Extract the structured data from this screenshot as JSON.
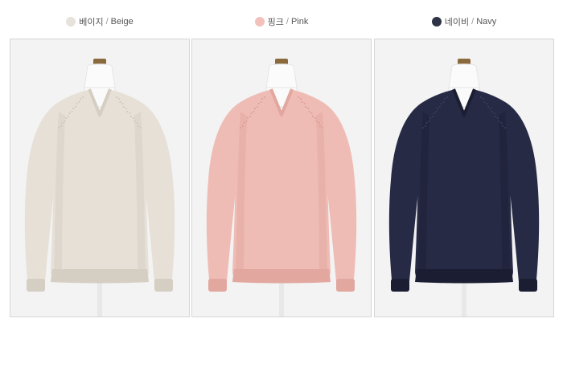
{
  "products": [
    {
      "name_ko": "베이지",
      "sep": "/",
      "name_en": "Beige",
      "swatch_color": "#e7e2db",
      "sweater_color": "#e6e0d7",
      "shade_color": "#d5cec3",
      "knit_color": "#cfc7bb"
    },
    {
      "name_ko": "핑크",
      "sep": "/",
      "name_en": "Pink",
      "swatch_color": "#f2c1bc",
      "sweater_color": "#efbcb5",
      "shade_color": "#e2a79f",
      "knit_color": "#dc9d95"
    },
    {
      "name_ko": "네이비",
      "sep": "/",
      "name_en": "Navy",
      "swatch_color": "#2f3346",
      "sweater_color": "#262a44",
      "shade_color": "#1b1e33",
      "knit_color": "#3a3f5c"
    }
  ],
  "icons": {
    "swatch": "color-dot-icon",
    "hanger": "hanger-icon"
  }
}
